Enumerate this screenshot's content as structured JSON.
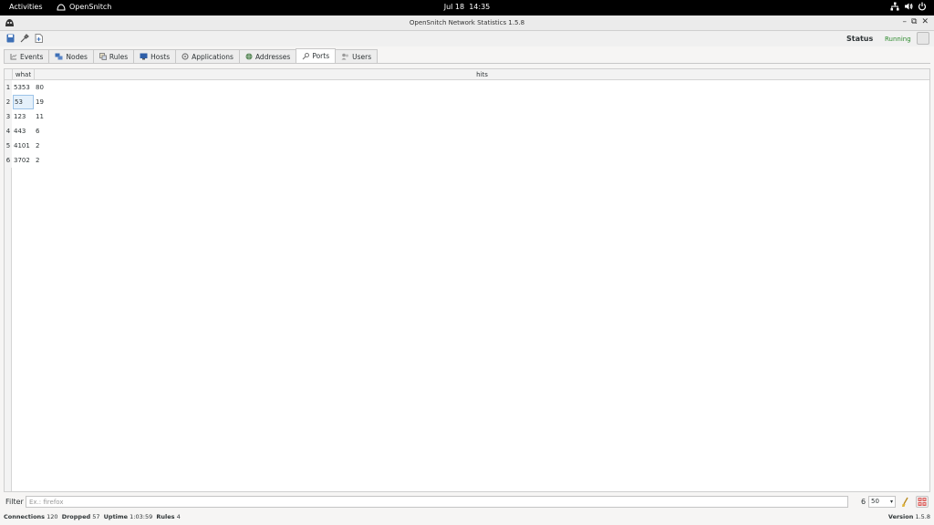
{
  "topbar": {
    "activities": "Activities",
    "app_name": "OpenSnitch",
    "date": "Jul 18",
    "time": "14:35"
  },
  "window": {
    "title": "OpenSnitch Network Statistics 1.5.8",
    "minimize": "–",
    "maximize": "⧉",
    "close": "✕"
  },
  "toolbar": {
    "status_label": "Status",
    "status_value": "Running",
    "status_color": "#2e8b2e"
  },
  "tabs": [
    {
      "label": "Events",
      "icon": "events-icon"
    },
    {
      "label": "Nodes",
      "icon": "nodes-icon"
    },
    {
      "label": "Rules",
      "icon": "rules-icon"
    },
    {
      "label": "Hosts",
      "icon": "hosts-icon"
    },
    {
      "label": "Applications",
      "icon": "applications-icon"
    },
    {
      "label": "Addresses",
      "icon": "addresses-icon"
    },
    {
      "label": "Ports",
      "icon": "ports-icon",
      "active": true
    },
    {
      "label": "Users",
      "icon": "users-icon"
    }
  ],
  "table": {
    "columns": [
      "what",
      "hits"
    ],
    "rows": [
      {
        "num": "1",
        "what": "5353",
        "hits": "80"
      },
      {
        "num": "2",
        "what": "53",
        "hits": "19"
      },
      {
        "num": "3",
        "what": "123",
        "hits": "11"
      },
      {
        "num": "4",
        "what": "443",
        "hits": "6"
      },
      {
        "num": "5",
        "what": "4101",
        "hits": "2"
      },
      {
        "num": "6",
        "what": "3702",
        "hits": "2"
      }
    ]
  },
  "filter": {
    "label": "Filter",
    "placeholder": "Ex.: firefox",
    "value": "",
    "row_count": "6",
    "limit": "50"
  },
  "statusbar": {
    "connections_label": "Connections",
    "connections": "120",
    "dropped_label": "Dropped",
    "dropped": "57",
    "uptime_label": "Uptime",
    "uptime": "1:03:59",
    "rules_label": "Rules",
    "rules": "4",
    "version_label": "Version",
    "version": "1.5.8"
  }
}
